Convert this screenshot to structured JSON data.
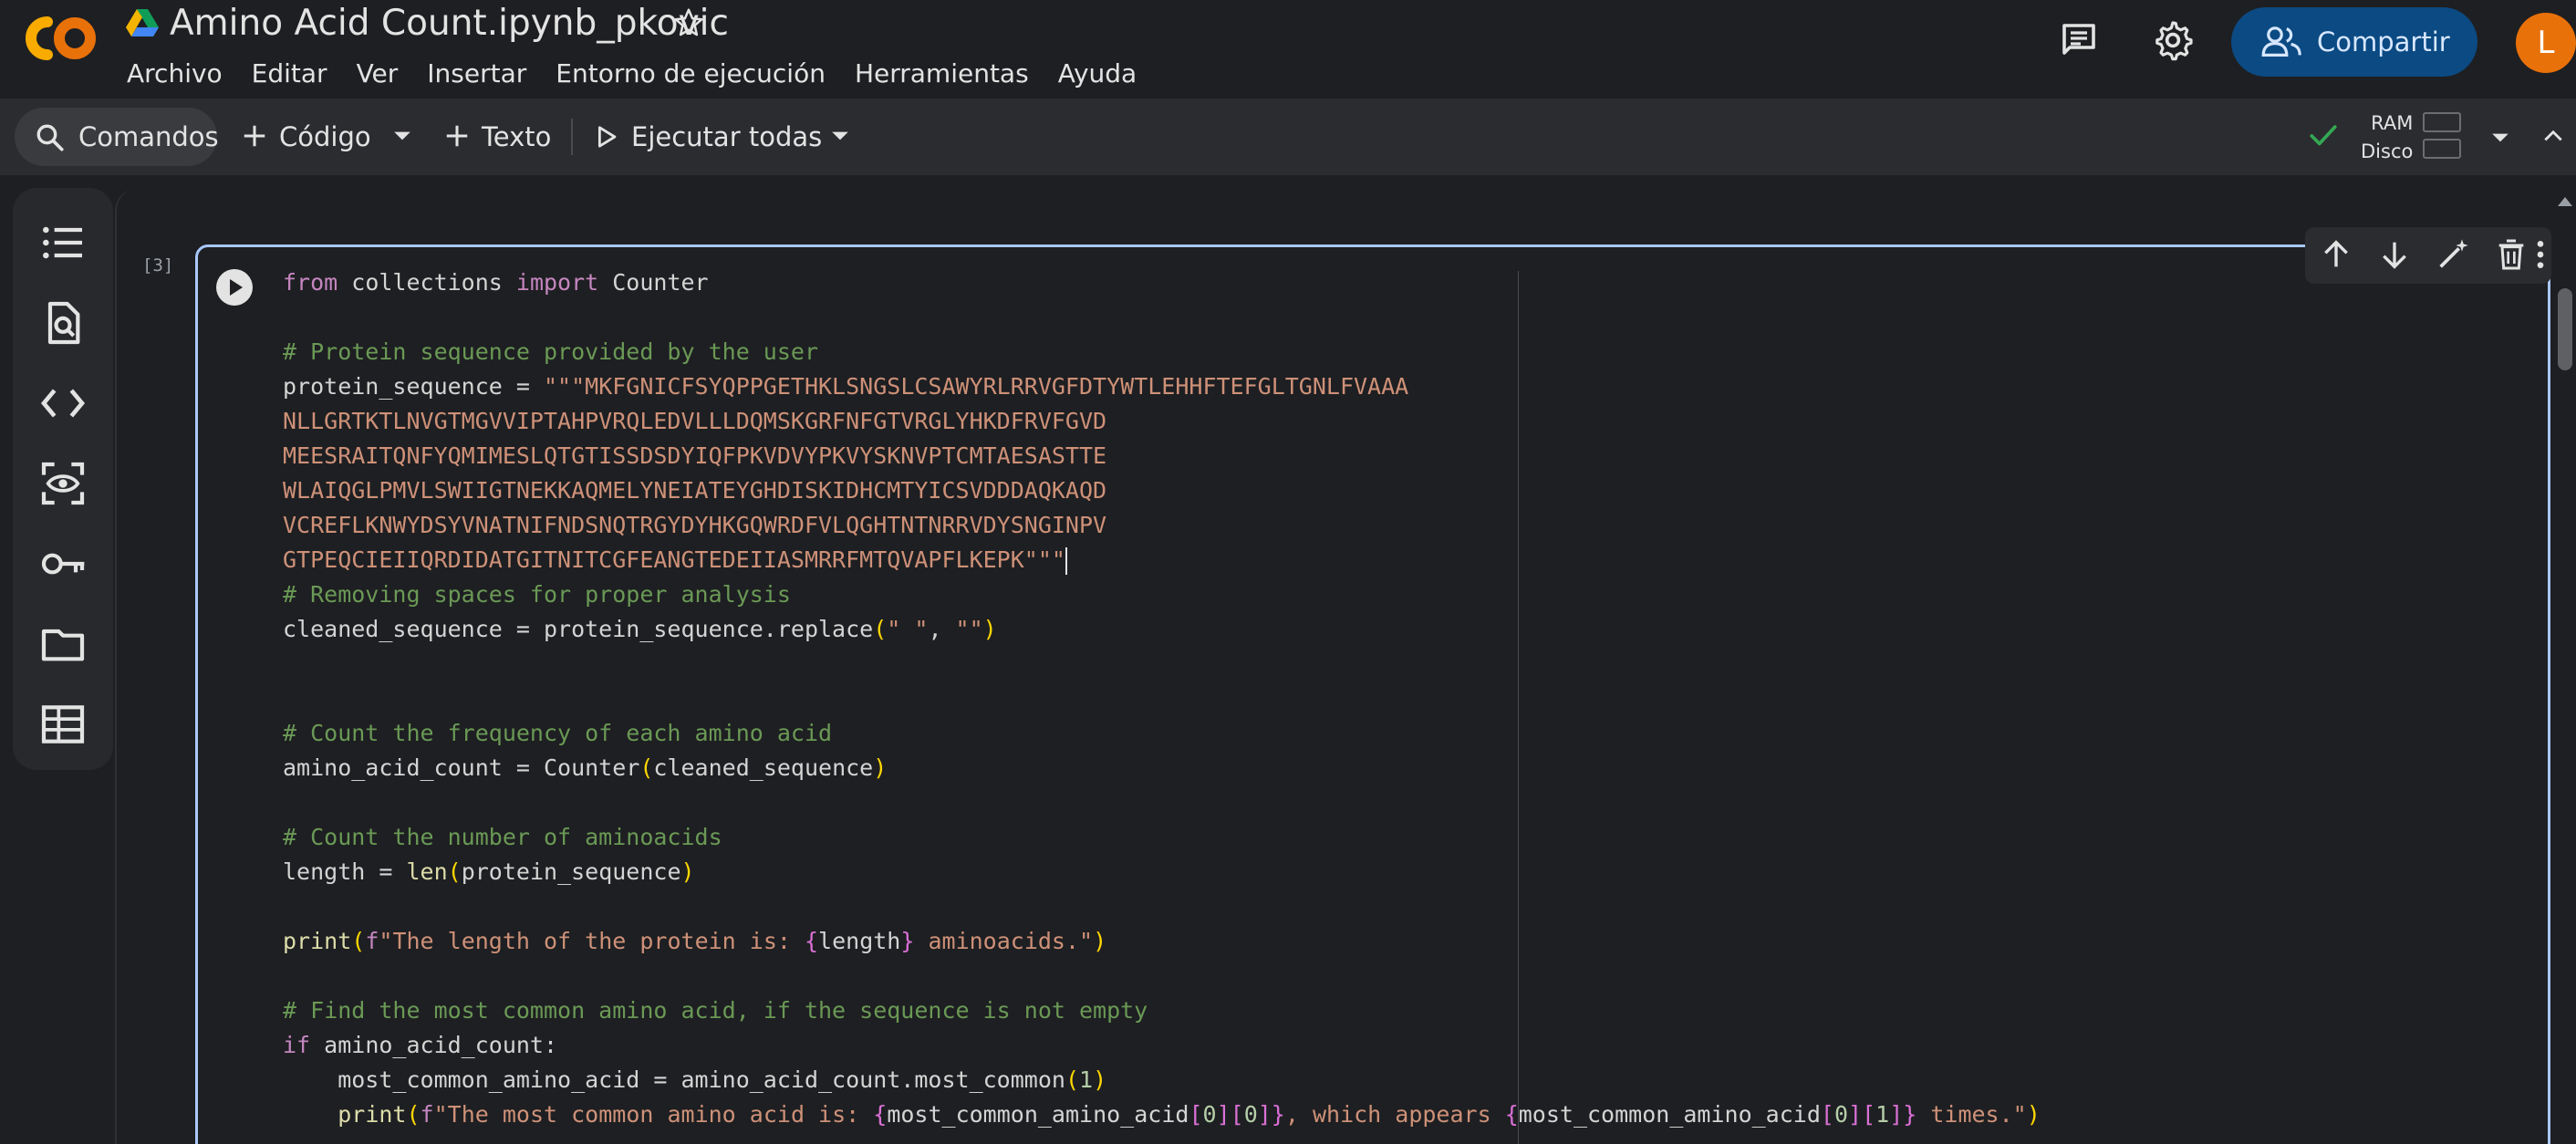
{
  "header": {
    "doc_title": "Amino Acid Count.ipynb_pkovic",
    "share_label": "Compartir",
    "avatar_letter": "L"
  },
  "menu": {
    "items": [
      "Archivo",
      "Editar",
      "Ver",
      "Insertar",
      "Entorno de ejecución",
      "Herramientas",
      "Ayuda"
    ]
  },
  "toolbar": {
    "commands_label": "Comandos",
    "code_label": "Código",
    "text_label": "Texto",
    "run_all_label": "Ejecutar todas",
    "ram_label": "RAM",
    "disk_label": "Disco"
  },
  "sidebar": {
    "icons": [
      "table-of-contents-icon",
      "find-replace-icon",
      "code-snippets-icon",
      "variables-inspector-icon",
      "secrets-key-icon",
      "files-folder-icon",
      "data-table-icon"
    ]
  },
  "cell": {
    "execution_count": "[3]",
    "code_lines": [
      "from collections import Counter",
      "",
      "# Protein sequence provided by the user",
      "protein_sequence = \"\"\"MKFGNICFSYQPPGETHKLSNGSLCSAWYRLRRVGFDTYWTLEHHFTEFGLTGNLFVAAA",
      "NLLGRTKTLNVGTMGVVIPTAHPVRQLEDVLLLDQMSKGRFNFGTVRGLYHKDFRVFGVD",
      "MEESRAITQNFYQMIMESLQTGTISSDSDYIQFPKVDVYPKVYSKNVPTCMTAESASTTE",
      "WLAIQGLPMVLSWIIGTNEKKAQMELYNEIATEYGHDISKIDHCMTYICSVDDDAQKAQD",
      "VCREFLKNWYDSYVNATNIFNDSNQTRGYDYHKGQWRDFVLQGHTNTNRRVDYSNGINPV",
      "GTPEQCIEIIQRDIDATGITNITCGFEANGTEDEIIASMRRFMTQVAPFLKEPK\"\"\"",
      "# Removing spaces for proper analysis",
      "cleaned_sequence = protein_sequence.replace(\" \", \"\")",
      "",
      "",
      "# Count the frequency of each amino acid",
      "amino_acid_count = Counter(cleaned_sequence)",
      "",
      "# Count the number of aminoacids",
      "length = len(protein_sequence)",
      "",
      "print(f\"The length of the protein is: {length} aminoacids.\")",
      "",
      "# Find the most common amino acid, if the sequence is not empty",
      "if amino_acid_count:",
      "    most_common_amino_acid = amino_acid_count.most_common(1)",
      "    print(f\"The most common amino acid is: {most_common_amino_acid[0][0]}, which appears {most_common_amino_acid[0][1]} times.\")"
    ]
  },
  "colors": {
    "accent": "#a8c7fa",
    "share_button": "#0b4a83",
    "avatar": "#e8710a",
    "status_ok": "#34a853"
  }
}
